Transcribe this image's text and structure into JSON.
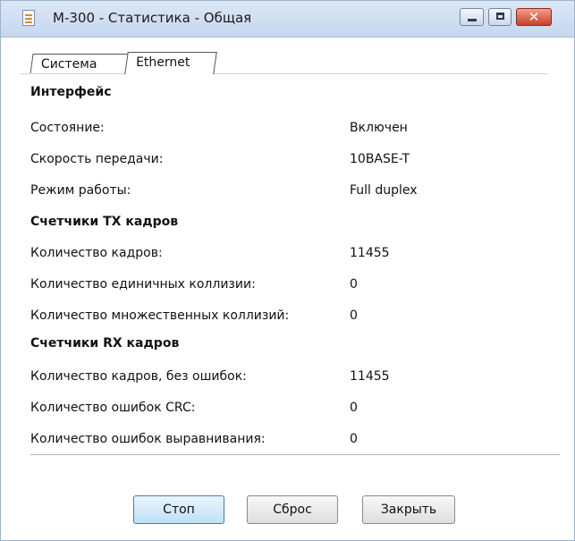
{
  "window": {
    "title": "М-300 - Статистика - Общая",
    "controls": {
      "minimize": "",
      "maximize": "",
      "close": "✕"
    }
  },
  "tabs": [
    {
      "label": "Система",
      "selected": false
    },
    {
      "label": "Ethernet",
      "selected": true
    }
  ],
  "sections": {
    "interface": {
      "title": "Интерфейс",
      "rows": [
        {
          "label": "Состояние:",
          "value": "Включен"
        },
        {
          "label": "Скорость передачи:",
          "value": "10BASE-T"
        },
        {
          "label": "Режим работы:",
          "value": "Full duplex"
        }
      ]
    },
    "tx": {
      "title": "Счетчики TX кадров",
      "rows": [
        {
          "label": "Количество кадров:",
          "value": "11455"
        },
        {
          "label": "Количество единичных коллизии:",
          "value": "0"
        },
        {
          "label": "Количество множественных коллизий:",
          "value": "0"
        }
      ]
    },
    "rx": {
      "title": "Счетчики RX кадров",
      "rows": [
        {
          "label": "Количество кадров, без ошибок:",
          "value": "11455"
        },
        {
          "label": "Количество ошибок CRC:",
          "value": "0"
        },
        {
          "label": "Количество ошибок выравнивания:",
          "value": "0"
        }
      ]
    }
  },
  "buttons": {
    "stop": "Стоп",
    "reset": "Сброс",
    "close": "Закрыть"
  }
}
